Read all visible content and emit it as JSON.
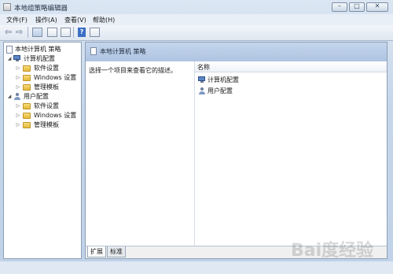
{
  "window": {
    "title": "本地组策略编辑器"
  },
  "menu": [
    "文件(F)",
    "操作(A)",
    "查看(V)",
    "帮助(H)"
  ],
  "tree": {
    "root": "本地计算机 策略",
    "computer": "计算机配置",
    "computer_children": [
      "软件设置",
      "Windows 设置",
      "管理模板"
    ],
    "user": "用户配置",
    "user_children": [
      "软件设置",
      "Windows 设置",
      "管理模板"
    ]
  },
  "content": {
    "header_title": "本地计算机 策略",
    "description": "选择一个项目来查看它的描述。",
    "column_name": "名称",
    "items": [
      "计算机配置",
      "用户配置"
    ]
  },
  "tabs": [
    "扩展",
    "标准"
  ],
  "watermark": "Bai度经验"
}
